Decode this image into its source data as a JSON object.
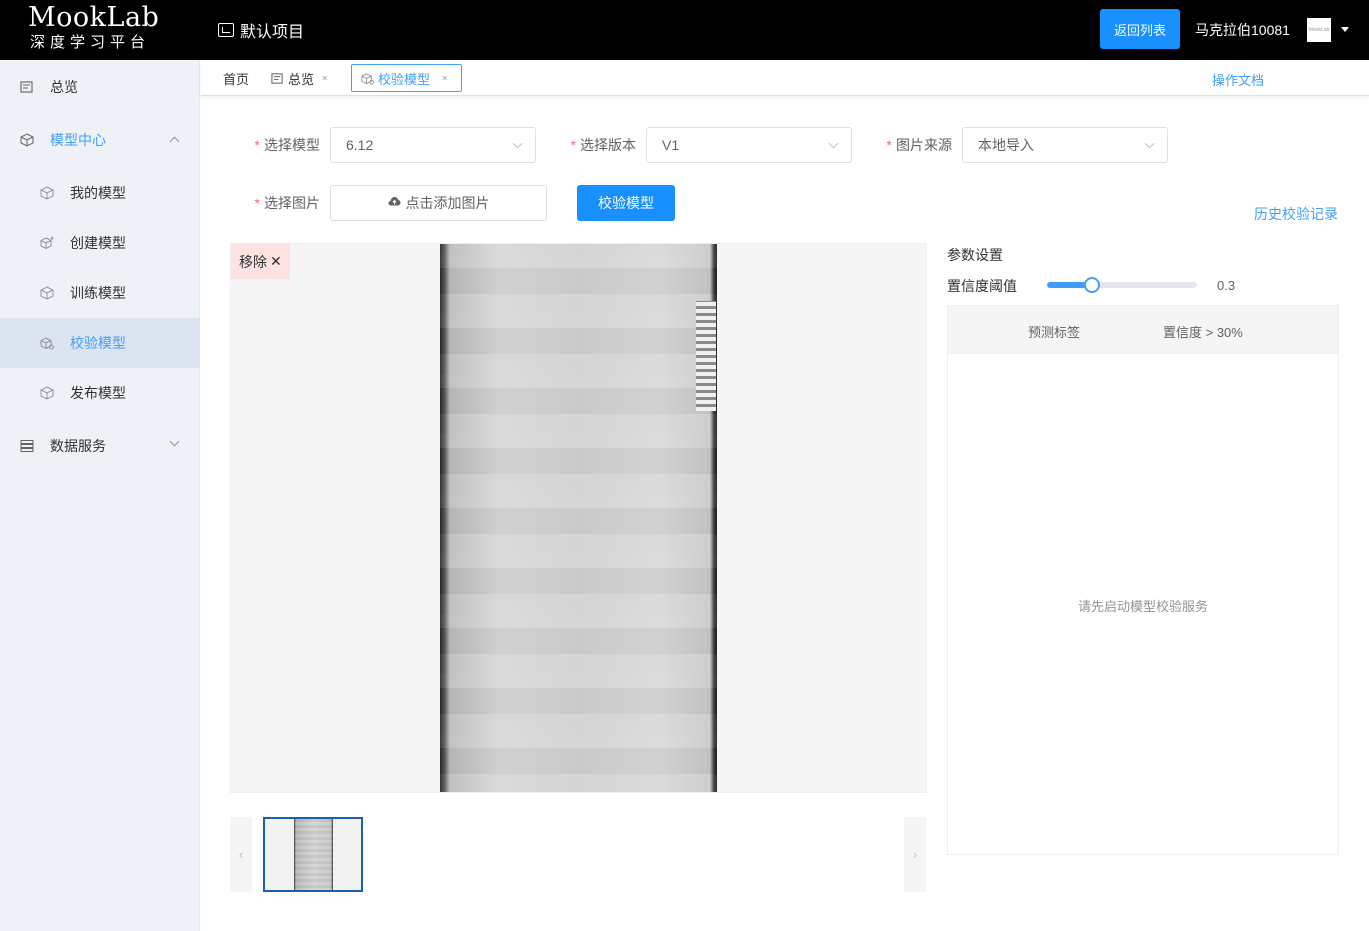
{
  "header": {
    "logo_title": "MookLab",
    "logo_subtitle": "深度学习平台",
    "project_name": "默认项目",
    "back_button": "返回列表",
    "username": "马克拉伯10081",
    "avatar_text": "MookLab"
  },
  "sidebar": {
    "items": [
      {
        "label": "总览",
        "icon": "overview-icon"
      },
      {
        "label": "模型中心",
        "icon": "cube-icon",
        "expanded": true
      },
      {
        "label": "我的模型",
        "icon": "cube-icon"
      },
      {
        "label": "创建模型",
        "icon": "cube-plus-icon"
      },
      {
        "label": "训练模型",
        "icon": "cube-icon"
      },
      {
        "label": "校验模型",
        "icon": "cube-check-icon",
        "active": true
      },
      {
        "label": "发布模型",
        "icon": "cube-icon"
      },
      {
        "label": "数据服务",
        "icon": "database-icon",
        "expanded": false
      }
    ]
  },
  "tabs": {
    "home": "首页",
    "overview": "总览",
    "active": "校验模型",
    "close": "×",
    "docs": "操作文档"
  },
  "form": {
    "required_mark": "*",
    "model_label": "选择模型",
    "model_value": "6.12",
    "version_label": "选择版本",
    "version_value": "V1",
    "source_label": "图片来源",
    "source_value": "本地导入",
    "image_label": "选择图片",
    "upload_button": "点击添加图片",
    "verify_button": "校验模型",
    "history_link": "历史校验记录"
  },
  "preview": {
    "remove_label": "移除",
    "remove_icon": "close-icon",
    "prev_icon": "chevron-left-icon",
    "next_icon": "chevron-right-icon"
  },
  "params": {
    "title": "参数设置",
    "threshold_label": "置信度阈值",
    "threshold_value": "0.3",
    "threshold_fraction": 0.3,
    "col_label": "预测标签",
    "col_confidence": "置信度 > 30%",
    "empty_text": "请先启动模型校验服务"
  },
  "colors": {
    "primary": "#1890ff",
    "link": "#409eff",
    "header_bg": "#000000",
    "sidebar_bg": "#eef1f6",
    "danger": "#f56c6c"
  }
}
